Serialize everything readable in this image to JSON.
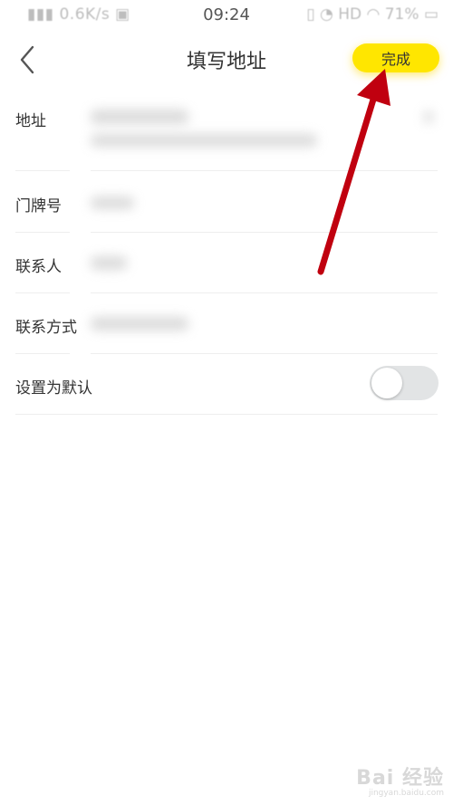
{
  "status_bar": {
    "network_speed": "0.6K/s",
    "time": "09:24",
    "network_type": "HD",
    "battery": "71%"
  },
  "nav": {
    "title": "填写地址",
    "done_label": "完成"
  },
  "form": {
    "address_label": "地址",
    "door_label": "门牌号",
    "contact_label": "联系人",
    "phone_label": "联系方式",
    "default_label": "设置为默认",
    "default_enabled": false
  },
  "colors": {
    "accent": "#ffe600",
    "arrow": "#c0000f",
    "toggle_off": "#e2e4e5"
  },
  "watermark": {
    "logo": "Bai 经验",
    "site": "jingyan.baidu.com"
  }
}
